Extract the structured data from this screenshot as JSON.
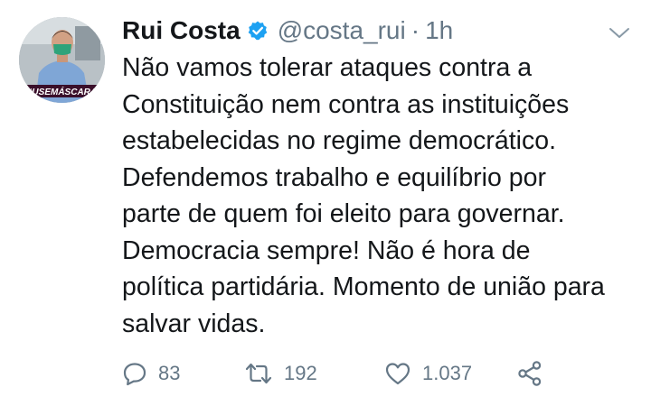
{
  "tweet": {
    "author_name": "Rui Costa",
    "handle": "@costa_rui",
    "separator": "·",
    "time": "1h",
    "avatar_caption": "#USEMÁSCARA",
    "text": "Não vamos tolerar ataques contra a\nConstituição nem contra as instituições\nestabelecidas no regime democrático.\nDefendemos trabalho e equilíbrio por\nparte de quem foi eleito para governar.\nDemocracia sempre! Não é hora de\npolítica partidária. Momento de união para\nsalvar vidas.",
    "replies": "83",
    "retweets": "192",
    "likes": "1.037"
  },
  "icons": {
    "verified": "verified-badge-icon",
    "menu": "chevron-down-icon",
    "reply": "reply-icon",
    "retweet": "retweet-icon",
    "like": "heart-icon",
    "share": "share-icon"
  },
  "colors": {
    "verified_blue": "#1da1f2",
    "secondary_text": "#657786",
    "primary_text": "#14171a",
    "avatar_caption": "#e0245e"
  }
}
